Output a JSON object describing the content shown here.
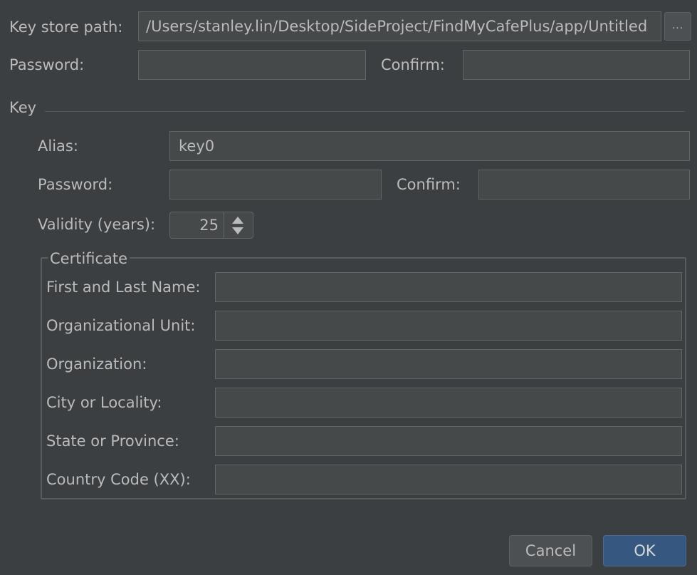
{
  "keystore": {
    "path_label": "Key store path:",
    "path_value": "/Users/stanley.lin/Desktop/SideProject/FindMyCafePlus/app/Untitled",
    "browse_label": "...",
    "password_label": "Password:",
    "password_value": "",
    "confirm_label": "Confirm:",
    "confirm_value": ""
  },
  "key": {
    "section_label": "Key",
    "alias_label": "Alias:",
    "alias_value": "key0",
    "password_label": "Password:",
    "password_value": "",
    "confirm_label": "Confirm:",
    "confirm_value": "",
    "validity_label": "Validity (years):",
    "validity_value": "25"
  },
  "certificate": {
    "legend": "Certificate",
    "fields": [
      {
        "label": "First and Last Name:",
        "value": ""
      },
      {
        "label": "Organizational Unit:",
        "value": ""
      },
      {
        "label": "Organization:",
        "value": ""
      },
      {
        "label": "City or Locality:",
        "value": ""
      },
      {
        "label": "State or Province:",
        "value": ""
      },
      {
        "label": "Country Code (XX):",
        "value": ""
      }
    ]
  },
  "buttons": {
    "cancel_label": "Cancel",
    "ok_label": "OK"
  },
  "colors": {
    "background": "#3c3f41",
    "field_background": "#45494a",
    "text": "#bbbbbb",
    "ok_button": "#365880"
  }
}
